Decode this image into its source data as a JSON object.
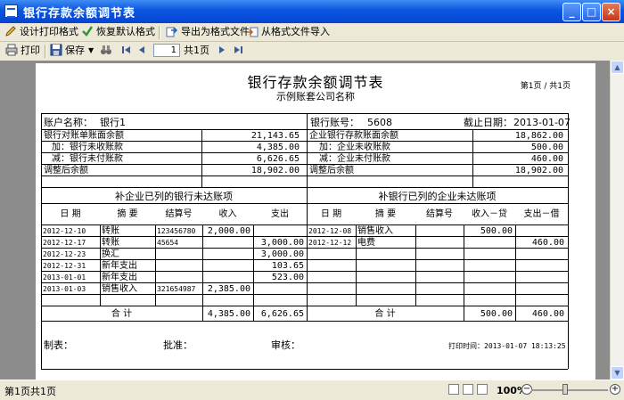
{
  "window": {
    "title": "银行存款余额调节表"
  },
  "toolbar1": {
    "design_label": "设计打印格式",
    "restore_label": "恢复默认格式",
    "export_label": "导出为格式文件",
    "import_label": "从格式文件导入"
  },
  "toolbar2": {
    "print_label": "打印",
    "save_label": "保存",
    "page_value": "1",
    "page_total": "共1页"
  },
  "report": {
    "title": "银行存款余额调节表",
    "company": "示例账套公司名称",
    "page_info": "第1页 / 共1页",
    "account_name_label": "账户名称：",
    "account_name": "银行1",
    "account_no_label": "银行账号：",
    "account_no": "5608",
    "end_date_label": "截止日期：",
    "end_date": "2013-01-07",
    "left_summary": [
      {
        "label": "银行对账单账面余额",
        "value": "21,143.65"
      },
      {
        "label": "加：银行未收账款",
        "value": "4,385.00"
      },
      {
        "label": "减：银行未付账款",
        "value": "6,626.65"
      },
      {
        "label": "调整后余额",
        "value": "18,902.00"
      }
    ],
    "right_summary": [
      {
        "label": "企业银行存款账面余额",
        "value": "18,862.00"
      },
      {
        "label": "加：企业未收账款",
        "value": "500.00"
      },
      {
        "label": "减：企业未付账款",
        "value": "460.00"
      },
      {
        "label": "调整后余额",
        "value": "18,902.00"
      }
    ],
    "left_section_title": "补企业已列的银行未达账项",
    "right_section_title": "补银行已列的企业未达账项",
    "left_headers": [
      "日 期",
      "摘 要",
      "结算号",
      "收入",
      "支出"
    ],
    "right_headers": [
      "日 期",
      "摘 要",
      "结算号",
      "收入－贷",
      "支出－借"
    ],
    "left_rows": [
      {
        "date": "2012-12-10",
        "summary": "转账",
        "settle": "123456780",
        "income": "2,000.00",
        "expense": ""
      },
      {
        "date": "2012-12-17",
        "summary": "转账",
        "settle": "45654",
        "income": "",
        "expense": "3,000.00"
      },
      {
        "date": "2012-12-23",
        "summary": "换汇",
        "settle": "",
        "income": "",
        "expense": "3,000.00"
      },
      {
        "date": "2012-12-31",
        "summary": "新年支出",
        "settle": "",
        "income": "",
        "expense": "103.65"
      },
      {
        "date": "2013-01-01",
        "summary": "新年支出",
        "settle": "",
        "income": "",
        "expense": "523.00"
      },
      {
        "date": "2013-01-03",
        "summary": "销售收入",
        "settle": "321654987",
        "income": "2,385.00",
        "expense": ""
      }
    ],
    "right_rows": [
      {
        "date": "2012-12-08",
        "summary": "销售收入",
        "settle": "",
        "income": "500.00",
        "expense": ""
      },
      {
        "date": "2012-12-12",
        "summary": "电费",
        "settle": "",
        "income": "",
        "expense": "460.00"
      }
    ],
    "total_label": "合 计",
    "left_total_income": "4,385.00",
    "left_total_expense": "6,626.65",
    "right_total_income": "500.00",
    "right_total_expense": "460.00",
    "maker_label": "制表：",
    "approve_label": "批准：",
    "audit_label": "审核：",
    "print_time": "打印时间：2013-01-07 18:13:25"
  },
  "status": {
    "text": "第1页共1页",
    "zoom": "100%"
  }
}
